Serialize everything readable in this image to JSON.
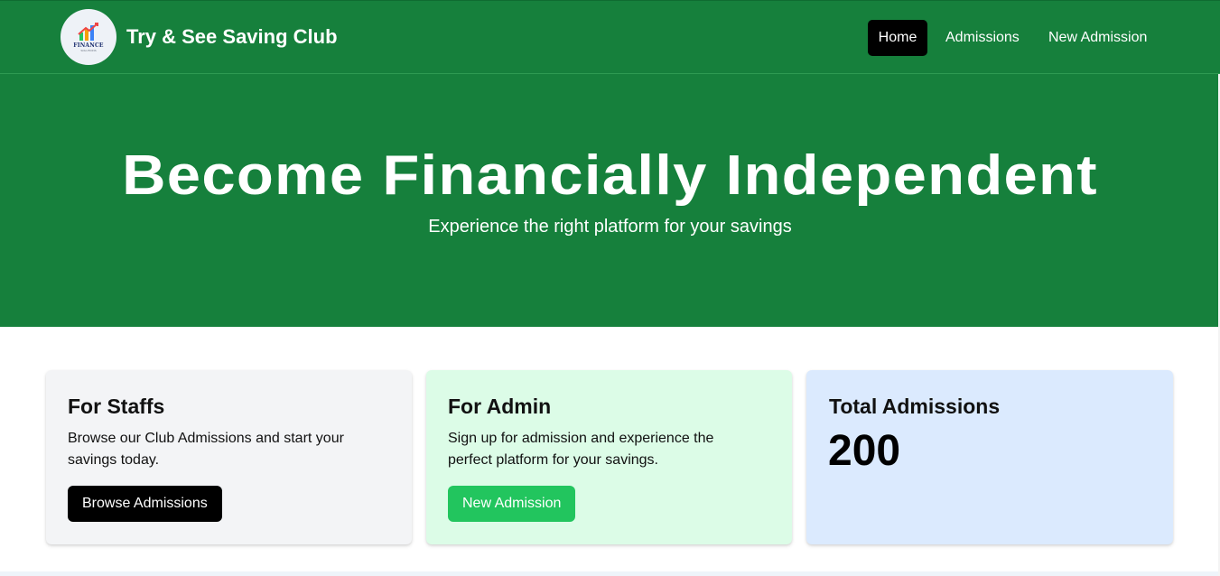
{
  "brand": {
    "name": "Try & See Saving Club",
    "logo_text": "FINANCE",
    "logo_subtext": "SOLUTIONS"
  },
  "nav": {
    "items": [
      {
        "label": "Home",
        "active": true
      },
      {
        "label": "Admissions",
        "active": false
      },
      {
        "label": "New Admission",
        "active": false
      }
    ]
  },
  "hero": {
    "title": "Become Financially Independent",
    "subtitle": "Experience the right platform for your savings"
  },
  "cards": {
    "staff": {
      "title": "For Staffs",
      "text": "Browse our Club Admissions and start your savings today.",
      "button": "Browse Admissions"
    },
    "admin": {
      "title": "For Admin",
      "text": "Sign up for admission and experience the perfect platform for your savings.",
      "button": "New Admission"
    },
    "total": {
      "title": "Total Admissions",
      "count": "200"
    }
  },
  "colors": {
    "primary_green": "#16803c",
    "button_green": "#22c55e",
    "admin_card_bg": "#dcfce7",
    "total_card_bg": "#dbeafe",
    "staff_card_bg": "#f3f4f6"
  },
  "icons": {
    "logo": "finance-logo-icon"
  }
}
